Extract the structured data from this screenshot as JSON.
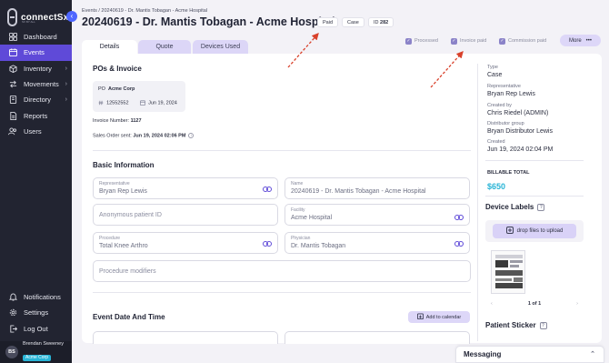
{
  "brand": {
    "name": "connectSx",
    "tagline": "SX BY ALL"
  },
  "sidebar": {
    "items": [
      {
        "label": "Dashboard",
        "icon": "dashboard-icon"
      },
      {
        "label": "Events",
        "icon": "calendar-icon",
        "active": true
      },
      {
        "label": "Inventory",
        "icon": "box-icon"
      },
      {
        "label": "Movements",
        "icon": "movements-icon"
      },
      {
        "label": "Directory",
        "icon": "directory-icon"
      },
      {
        "label": "Reports",
        "icon": "reports-icon"
      },
      {
        "label": "Users",
        "icon": "users-icon"
      }
    ],
    "bottom_items": [
      {
        "label": "Notifications",
        "icon": "bell-icon"
      },
      {
        "label": "Settings",
        "icon": "gear-icon"
      },
      {
        "label": "Log Out",
        "icon": "logout-icon"
      }
    ],
    "user": {
      "initials": "BS",
      "name": "Brendan Sweeney",
      "company": "Acme Corp"
    }
  },
  "header": {
    "breadcrumb": "Events / 20240619 - Dr. Mantis Tobagan - Acme Hospital",
    "title": "20240619 - Dr. Mantis Tobagan - Acme Hospital",
    "badges": {
      "paid": "Paid",
      "case": "Case",
      "id_label": "ID",
      "id_value": "282"
    }
  },
  "tabs": [
    "Details",
    "Quote",
    "Devices Used"
  ],
  "status_checks": {
    "processed": "Processed",
    "invoice_paid": "Invoice paid",
    "commission_paid": "Commission paid"
  },
  "more_label": "More",
  "po_invoice": {
    "section_title": "POs & Invoice",
    "po_label": "PO",
    "po_company": "Acme Corp",
    "po_number": "12552552",
    "po_date": "Jun 19, 2024",
    "invoice_label": "Invoice Number:",
    "invoice_number": "1127",
    "sales_order_label": "Sales Order sent:",
    "sales_order_value": "Jun 19, 2024 02:06 PM"
  },
  "basic_info": {
    "section_title": "Basic Information",
    "representative": {
      "label": "Representative",
      "value": "Bryan Rep Lewis"
    },
    "name": {
      "label": "Name",
      "value": "20240619 - Dr. Mantis Tobagan - Acme Hospital"
    },
    "patient_id": {
      "placeholder": "Anonymous patient ID"
    },
    "facility": {
      "label": "Facility",
      "value": "Acme Hospital"
    },
    "procedure": {
      "label": "Procedure",
      "value": "Total Knee Arthro"
    },
    "physician": {
      "label": "Physician",
      "value": "Dr. Mantis Tobagan"
    },
    "procedure_modifiers": {
      "placeholder": "Procedure modifiers"
    }
  },
  "event_date": {
    "section_title": "Event Date And Time",
    "add_calendar": "Add to calendar"
  },
  "right_panel": {
    "type_label": "Type",
    "type_value": "Case",
    "rep_label": "Representative",
    "rep_value": "Bryan Rep Lewis",
    "created_by_label": "Created by",
    "created_by_value": "Chris Riedel (ADMIN)",
    "distributor_label": "Distributor group",
    "distributor_value": "Bryan Distributor Lewis",
    "created_label": "Created",
    "created_value": "Jun 19, 2024 02:04 PM",
    "billable_label": "BILLABLE TOTAL",
    "billable_value": "$650",
    "device_labels_title": "Device Labels",
    "drop_files": "drop files to upload",
    "pager": "1 of 1",
    "patient_sticker_title": "Patient Sticker"
  },
  "messaging": {
    "label": "Messaging"
  },
  "colors": {
    "sidebar": "#222431",
    "active": "#5f4ad8",
    "accent": "#28b4d6",
    "tab_bg": "#dcd6f7",
    "arrow": "#d9412b"
  }
}
